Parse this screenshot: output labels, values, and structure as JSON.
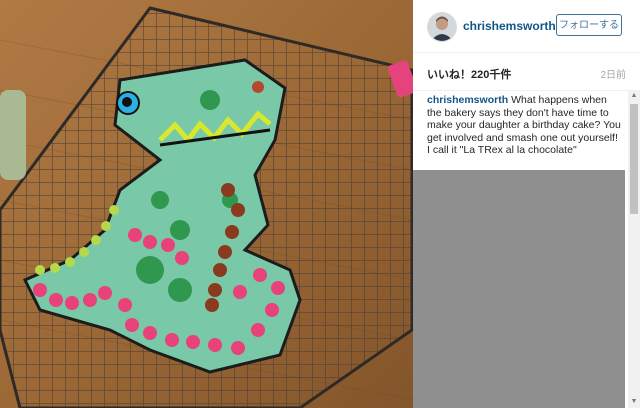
{
  "post": {
    "username": "chrishemsworth",
    "follow_label": "フォローする",
    "likes": "いいね！220千件",
    "time_ago": "2日前",
    "caption_user": "chrishemsworth",
    "caption_text": "What happens when the bakery says they don't have time to make your daughter a birthday cake? You get involved and smash one out yourself! I call it \"La TRex al la chocolate\""
  },
  "icons": {
    "avatar": "profile-photo",
    "scroll_up": "arrow-up-icon",
    "scroll_down": "arrow-down-icon"
  },
  "colors": {
    "link": "#125688",
    "follow_border": "#3f729b",
    "muted": "#a5a7aa"
  }
}
